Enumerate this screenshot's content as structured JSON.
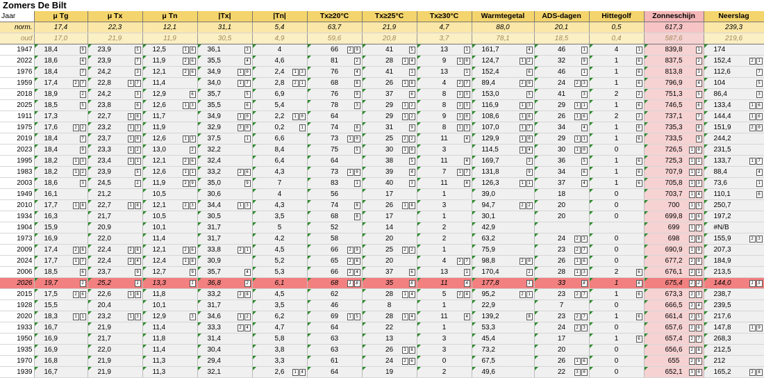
{
  "title": "Zomers De Bilt",
  "headers": [
    "Jaar",
    "μ Tg",
    "μ Tx",
    "μ Tn",
    "|Tx|",
    "|Tn|",
    "Tx≥20°C",
    "Tx≥25°C",
    "Tx≥30°C",
    "Warmtegetal",
    "ADS-dagen",
    "Hittegolf",
    "Zonneschijn",
    "Neerslag"
  ],
  "norm": {
    "label": "norm.",
    "values": [
      "17,4",
      "22,3",
      "12,1",
      "31,1",
      "5,4",
      "63,7",
      "21,9",
      "4,7",
      "88,0",
      "20,1",
      "0,5",
      "617,3",
      "239,3"
    ]
  },
  "oud": {
    "label": "oud",
    "values": [
      "17,0",
      "21,9",
      "11,9",
      "30,5",
      "4,9",
      "59,6",
      "20,8",
      "3,7",
      "78,1",
      "18,5",
      "0,4",
      "587,6",
      "219,6"
    ]
  },
  "rows": [
    {
      "y": "1947",
      "v": [
        "18,4",
        "23,9",
        "12,5",
        "36,1",
        "4",
        "66",
        "41",
        "13",
        "161,7",
        "46",
        "4",
        "839,8",
        "174"
      ],
      "r": [
        "9",
        "5",
        "16",
        "3",
        "",
        "29",
        "5",
        "1",
        "4",
        "1",
        "1",
        "1",
        ""
      ]
    },
    {
      "y": "2022",
      "v": [
        "18,6",
        "23,9",
        "11,9",
        "35,5",
        "4,6",
        "81",
        "28",
        "9",
        "124,7",
        "32",
        "1",
        "837,5",
        "152,4"
      ],
      "r": [
        "4",
        "7",
        "26",
        "4",
        "",
        "2",
        "14",
        "10",
        "12",
        "9",
        "6",
        "2",
        "21"
      ]
    },
    {
      "y": "1976",
      "v": [
        "18,4",
        "24,2",
        "12,1",
        "34,9",
        "2,4",
        "76",
        "41",
        "13",
        "152,4",
        "46",
        "1",
        "813,8",
        "112,6"
      ],
      "r": [
        "7",
        "3",
        "26",
        "10",
        "13",
        "4",
        "1",
        "1",
        "6",
        "1",
        "6",
        "3",
        "7"
      ]
    },
    {
      "y": "1959",
      "v": [
        "17,4",
        "22,8",
        "11,4",
        "34,0",
        "2,8",
        "68",
        "26",
        "4",
        "89,4",
        "24",
        "1",
        "796,9",
        "104"
      ],
      "r": [
        "27",
        "17",
        "",
        "17",
        "21",
        "8",
        "18",
        "27",
        "29",
        "23",
        "6",
        "4",
        "5"
      ]
    },
    {
      "y": "2018",
      "v": [
        "18,9",
        "24,2",
        "12,9",
        "35,7",
        "6,9",
        "76",
        "37",
        "8",
        "153,0",
        "41",
        "2",
        "751,3",
        "86,4"
      ],
      "r": [
        "2",
        "3",
        "6",
        "5",
        "",
        "9",
        "6",
        "13",
        "5",
        "3",
        "2",
        "5",
        "3"
      ]
    },
    {
      "y": "2025",
      "v": [
        "18,5",
        "23,8",
        "12,6",
        "35,5",
        "5,4",
        "78",
        "29",
        "8",
        "116,9",
        "29",
        "1",
        "746,5",
        "133,4"
      ],
      "r": [
        "5",
        "6",
        "13",
        "6",
        "",
        "3",
        "12",
        "13",
        "13",
        "11",
        "6",
        "6",
        "16"
      ]
    },
    {
      "y": "1911",
      "v": [
        "17,3",
        "22,7",
        "11,7",
        "34,9",
        "2,2",
        "64",
        "29",
        "9",
        "108,6",
        "26",
        "2",
        "737,1",
        "144,4"
      ],
      "r": [
        "",
        "18",
        "",
        "10",
        "10",
        "",
        "12",
        "10",
        "16",
        "16",
        "2",
        "7",
        "16"
      ]
    },
    {
      "y": "1975",
      "v": [
        "17,6",
        "23,2",
        "11,9",
        "32,9",
        "0,2",
        "74",
        "31",
        "8",
        "107,0",
        "34",
        "1",
        "735,3",
        "151,9"
      ],
      "r": [
        "22",
        "13",
        "",
        "30",
        "1",
        "8",
        "9",
        "13",
        "17",
        "4",
        "6",
        "8",
        "20"
      ]
    },
    {
      "y": "2019",
      "v": [
        "18,4",
        "23,7",
        "12,6",
        "37,5",
        "6,6",
        "73",
        "25",
        "11",
        "129,9",
        "29",
        "1",
        "733,5",
        "244,2"
      ],
      "r": [
        "7",
        "10",
        "13",
        "1",
        "",
        "10",
        "22",
        "4",
        "10",
        "11",
        "6",
        "9",
        ""
      ]
    },
    {
      "y": "2023",
      "v": [
        "18,4",
        "23,3",
        "13,0",
        "32,2",
        "8,4",
        "75",
        "30",
        "3",
        "114,5",
        "30",
        "0",
        "726,5",
        "231,5"
      ],
      "r": [
        "9",
        "12",
        "2",
        "",
        "",
        "5",
        "10",
        "",
        "14",
        "10",
        "",
        "10",
        ""
      ]
    },
    {
      "y": "1995",
      "v": [
        "18,2",
        "23,4",
        "12,1",
        "32,4",
        "6,4",
        "64",
        "38",
        "11",
        "169,7",
        "36",
        "1",
        "725,3",
        "133,7"
      ],
      "r": [
        "13",
        "11",
        "26",
        "",
        "",
        "",
        "5",
        "4",
        "3",
        "5",
        "6",
        "11",
        "17"
      ]
    },
    {
      "y": "1983",
      "v": [
        "18,2",
        "23,9",
        "12,6",
        "33,2",
        "4,3",
        "73",
        "39",
        "7",
        "131,8",
        "34",
        "1",
        "707,9",
        "88,4"
      ],
      "r": [
        "12",
        "5",
        "11",
        "26",
        "",
        "10",
        "4",
        "17",
        "9",
        "6",
        "6",
        "12",
        "4"
      ]
    },
    {
      "y": "2003",
      "v": [
        "18,6",
        "24,5",
        "11,9",
        "35,0",
        "7",
        "83",
        "40",
        "11",
        "126,3",
        "37",
        "1",
        "705,8",
        "73,6"
      ],
      "r": [
        "3",
        "2",
        "29",
        "9",
        "",
        "1",
        "3",
        "4",
        "11",
        "4",
        "6",
        "13",
        "1"
      ]
    },
    {
      "y": "1949",
      "v": [
        "16,1",
        "21,2",
        "10,5",
        "30,6",
        "4",
        "56",
        "17",
        "1",
        "39,0",
        "18",
        "0",
        "703,7",
        "110,1"
      ],
      "r": [
        "",
        "",
        "",
        "",
        "",
        "",
        "",
        "",
        "",
        "",
        "",
        "14",
        "6"
      ]
    },
    {
      "y": "2010",
      "v": [
        "17,7",
        "22,7",
        "12,1",
        "34,4",
        "4,3",
        "74",
        "26",
        "3",
        "94,7",
        "20",
        "0",
        "700",
        "250,7"
      ],
      "r": [
        "18",
        "18",
        "23",
        "13",
        "",
        "8",
        "18",
        "",
        "22",
        "",
        "",
        "15",
        ""
      ]
    },
    {
      "y": "1934",
      "v": [
        "16,3",
        "21,7",
        "10,5",
        "30,5",
        "3,5",
        "68",
        "17",
        "1",
        "30,1",
        "20",
        "0",
        "699,8",
        "197,2"
      ],
      "r": [
        "",
        "",
        "",
        "",
        "",
        "8",
        "",
        "",
        "",
        "",
        "",
        "16",
        ""
      ]
    },
    {
      "y": "1904",
      "v": [
        "15,9",
        "20,9",
        "10,1",
        "31,7",
        "5",
        "52",
        "14",
        "2",
        "42,9",
        "",
        "",
        "699",
        "#N/B"
      ],
      "r": [
        "",
        "",
        "",
        "",
        "",
        "",
        "",
        "",
        "",
        "",
        "",
        "17",
        ""
      ]
    },
    {
      "y": "1973",
      "v": [
        "16,9",
        "22,0",
        "11,4",
        "31,7",
        "4,2",
        "58",
        "20",
        "2",
        "63,2",
        "24",
        "0",
        "698",
        "155,9"
      ],
      "r": [
        "",
        "",
        "",
        "",
        "",
        "",
        "",
        "",
        "",
        "23",
        "",
        "18",
        "23"
      ]
    },
    {
      "y": "2009",
      "v": [
        "17,4",
        "22,4",
        "12,1",
        "33,8",
        "4,5",
        "66",
        "25",
        "1",
        "75,9",
        "23",
        "0",
        "690,9",
        "207,3"
      ],
      "r": [
        "28",
        "28",
        "26",
        "21",
        "",
        "29",
        "22",
        "",
        "",
        "27",
        "",
        "19",
        ""
      ]
    },
    {
      "y": "2024",
      "v": [
        "17,7",
        "22,4",
        "12,4",
        "30,9",
        "5,2",
        "65",
        "20",
        "4",
        "98,8",
        "26",
        "0",
        "677,2",
        "184,9"
      ],
      "r": [
        "17",
        "24",
        "18",
        "",
        "",
        "28",
        "",
        "27",
        "20",
        "16",
        "",
        "20",
        ""
      ]
    },
    {
      "y": "2006",
      "v": [
        "18,5",
        "23,7",
        "12,7",
        "35,7",
        "5,3",
        "66",
        "37",
        "13",
        "170,4",
        "28",
        "2",
        "676,1",
        "213,5"
      ],
      "r": [
        "6",
        "9",
        "9",
        "4",
        "",
        "24",
        "6",
        "1",
        "2",
        "13",
        "6",
        "21",
        ""
      ]
    },
    {
      "y": "2026",
      "v": [
        "19,7",
        "25,2",
        "13,3",
        "36,8",
        "6,1",
        "68",
        "35",
        "11",
        "177,8",
        "33",
        "1",
        "675,4",
        "144,0"
      ],
      "r": [
        "1",
        "1",
        "1",
        "2",
        "",
        "18",
        "8",
        "4",
        "1",
        "8",
        "6",
        "22",
        "15"
      ],
      "hl": true
    },
    {
      "y": "2015",
      "v": [
        "17,5",
        "22,6",
        "11,8",
        "33,2",
        "4,5",
        "62",
        "28",
        "5",
        "95,2",
        "23",
        "1",
        "673,3",
        "238,7"
      ],
      "r": [
        "26",
        "18",
        "",
        "28",
        "",
        "",
        "14",
        "24",
        "21",
        "27",
        "6",
        "23",
        ""
      ]
    },
    {
      "y": "1928",
      "v": [
        "15,5",
        "20,4",
        "10,1",
        "31,7",
        "3,5",
        "46",
        "8",
        "1",
        "22,9",
        "7",
        "0",
        "666,5",
        "239,5"
      ],
      "r": [
        "",
        "",
        "",
        "",
        "",
        "",
        "",
        "",
        "",
        "",
        "",
        "24",
        ""
      ]
    },
    {
      "y": "2020",
      "v": [
        "18,3",
        "23,2",
        "12,9",
        "34,6",
        "6,2",
        "69",
        "28",
        "11",
        "139,2",
        "23",
        "1",
        "661,4",
        "217,6"
      ],
      "r": [
        "11",
        "13",
        "3",
        "12",
        "",
        "15",
        "14",
        "4",
        "8",
        "27",
        "6",
        "25",
        ""
      ]
    },
    {
      "y": "1933",
      "v": [
        "16,7",
        "21,9",
        "11,4",
        "33,3",
        "4,7",
        "64",
        "22",
        "1",
        "53,3",
        "24",
        "0",
        "657,6",
        "147,8"
      ],
      "r": [
        "",
        "",
        "",
        "24",
        "",
        "",
        "",
        "",
        "",
        "23",
        "",
        "26",
        "19"
      ]
    },
    {
      "y": "1950",
      "v": [
        "16,9",
        "21,7",
        "11,8",
        "31,4",
        "5,8",
        "63",
        "13",
        "3",
        "45,4",
        "17",
        "1",
        "657,4",
        "268,3"
      ],
      "r": [
        "",
        "",
        "",
        "",
        "",
        "",
        "",
        "",
        "",
        "",
        "6",
        "27",
        ""
      ]
    },
    {
      "y": "1935",
      "v": [
        "16,9",
        "22,0",
        "11,4",
        "30,4",
        "3,8",
        "63",
        "26",
        "3",
        "73,2",
        "20",
        "0",
        "656,6",
        "212,5"
      ],
      "r": [
        "",
        "",
        "",
        "",
        "",
        "",
        "18",
        "",
        "",
        "",
        "",
        "28",
        ""
      ]
    },
    {
      "y": "1970",
      "v": [
        "16,8",
        "21,9",
        "11,3",
        "29,4",
        "3,3",
        "61",
        "24",
        "0",
        "67,5",
        "26",
        "0",
        "655",
        "212"
      ],
      "r": [
        "",
        "",
        "",
        "",
        "",
        "",
        "26",
        "",
        "",
        "16",
        "",
        "29",
        ""
      ]
    },
    {
      "y": "1939",
      "v": [
        "16,7",
        "21,9",
        "11,3",
        "32,1",
        "2,6",
        "64",
        "19",
        "2",
        "49,6",
        "22",
        "0",
        "652,1",
        "165,2"
      ],
      "r": [
        "",
        "",
        "",
        "",
        "14",
        "",
        "",
        "",
        "",
        "30",
        "",
        "30",
        "28"
      ]
    }
  ]
}
